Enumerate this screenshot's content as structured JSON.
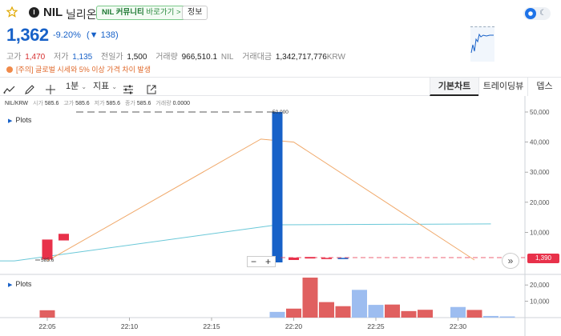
{
  "header": {
    "symbol": "NIL",
    "name_kr": "닐리온",
    "logo_letter": "I",
    "community": {
      "prefix": "NIL 커뮤니티",
      "label": "바로가기 >"
    },
    "info_label": "정보"
  },
  "ticker": {
    "price": "1,362",
    "change_pct": "-9.20%",
    "change_abs": "(▼ 138)"
  },
  "stats": {
    "high_label": "고가",
    "high": "1,470",
    "low_label": "저가",
    "low": "1,135",
    "prev_label": "전일가",
    "prev": "1,500",
    "volume_label": "거래량",
    "volume": "966,510.1",
    "volume_unit": "NIL",
    "value_label": "거래대금",
    "value": "1,342,717,776",
    "value_unit": "KRW"
  },
  "warning": "[주의] 글로벌 시세와 5% 이상 가격 차이 발생",
  "toolbar": {
    "interval": "1분",
    "indicator": "지표",
    "tabs": [
      "기본차트",
      "트레이딩뷰",
      "뎁스"
    ]
  },
  "chart": {
    "pair": "NIL/KRW",
    "ohlc": [
      {
        "label": "시가",
        "value": "585.6"
      },
      {
        "label": "고가",
        "value": "585.6"
      },
      {
        "label": "저가",
        "value": "585.6"
      },
      {
        "label": "종가",
        "value": "585.6"
      },
      {
        "label": "거래량",
        "value": "0.0000"
      }
    ],
    "plots_label": "Plots",
    "plots_label_volume": "Plots",
    "peak_label": "50,000",
    "low_marker": "585.6",
    "current_price_tag": "1,390",
    "zoom_minus": "−",
    "zoom_plus": "+",
    "forward": "»",
    "colors": {
      "up": "#e8314a",
      "down": "#1761c8",
      "ma_orange": "#f0a869",
      "ma_cyan": "#6ac8d8",
      "vol_red": "#e06060",
      "vol_blue": "#9dbdf0"
    }
  },
  "chart_data": {
    "type": "bar",
    "title": "",
    "xlabel": "",
    "ylabel": "",
    "x_ticks": [
      "22:05",
      "22:10",
      "22:15",
      "22:20",
      "22:25",
      "22:30"
    ],
    "price_axis": {
      "ticks": [
        "50,000",
        "40,000",
        "30,000",
        "20,000",
        "10,000"
      ],
      "ylim": [
        0,
        51500
      ]
    },
    "volume_axis": {
      "ticks": [
        "20,000",
        "10,000"
      ],
      "ylim": [
        0,
        26000
      ]
    },
    "candles": [
      {
        "t": "22:05",
        "open": 1000,
        "close": 7600,
        "high": 7600,
        "low": 1000,
        "dir": "up"
      },
      {
        "t": "22:06",
        "open": 7300,
        "close": 9500,
        "high": 9500,
        "low": 7300,
        "dir": "up"
      },
      {
        "t": "22:19",
        "open": 50000,
        "close": 0,
        "high": 50000,
        "low": 0,
        "dir": "down"
      },
      {
        "t": "22:20",
        "open": 800,
        "close": 1600,
        "high": 1600,
        "low": 800,
        "dir": "up"
      },
      {
        "t": "22:21",
        "open": 1300,
        "close": 1800,
        "high": 1800,
        "low": 1300,
        "dir": "up"
      },
      {
        "t": "22:22",
        "open": 1500,
        "close": 1500,
        "high": 1500,
        "low": 1500,
        "dir": "up"
      },
      {
        "t": "22:23",
        "open": 1200,
        "close": 1500,
        "high": 1500,
        "low": 1200,
        "dir": "down"
      }
    ],
    "ma_orange": [
      {
        "t": "22:05",
        "v": 500
      },
      {
        "t": "22:18",
        "v": 41000
      },
      {
        "t": "22:20",
        "v": 40000
      },
      {
        "t": "22:31",
        "v": 800
      }
    ],
    "ma_cyan": [
      {
        "t": "22:03",
        "v": 500
      },
      {
        "t": "22:19",
        "v": 12500
      },
      {
        "t": "22:32",
        "v": 12800
      }
    ],
    "volume": [
      {
        "t": "22:05",
        "v": 4500,
        "dir": "up"
      },
      {
        "t": "22:19",
        "v": 3500,
        "dir": "down"
      },
      {
        "t": "22:20",
        "v": 5500,
        "dir": "up"
      },
      {
        "t": "22:21",
        "v": 24500,
        "dir": "up"
      },
      {
        "t": "22:22",
        "v": 9500,
        "dir": "up"
      },
      {
        "t": "22:23",
        "v": 7000,
        "dir": "up"
      },
      {
        "t": "22:24",
        "v": 17000,
        "dir": "down"
      },
      {
        "t": "22:25",
        "v": 7800,
        "dir": "down"
      },
      {
        "t": "22:26",
        "v": 8000,
        "dir": "up"
      },
      {
        "t": "22:27",
        "v": 4000,
        "dir": "up"
      },
      {
        "t": "22:28",
        "v": 4800,
        "dir": "up"
      },
      {
        "t": "22:30",
        "v": 6500,
        "dir": "down"
      },
      {
        "t": "22:31",
        "v": 4700,
        "dir": "up"
      },
      {
        "t": "22:32",
        "v": 1000,
        "dir": "down"
      },
      {
        "t": "22:33",
        "v": 700,
        "dir": "down"
      }
    ]
  }
}
